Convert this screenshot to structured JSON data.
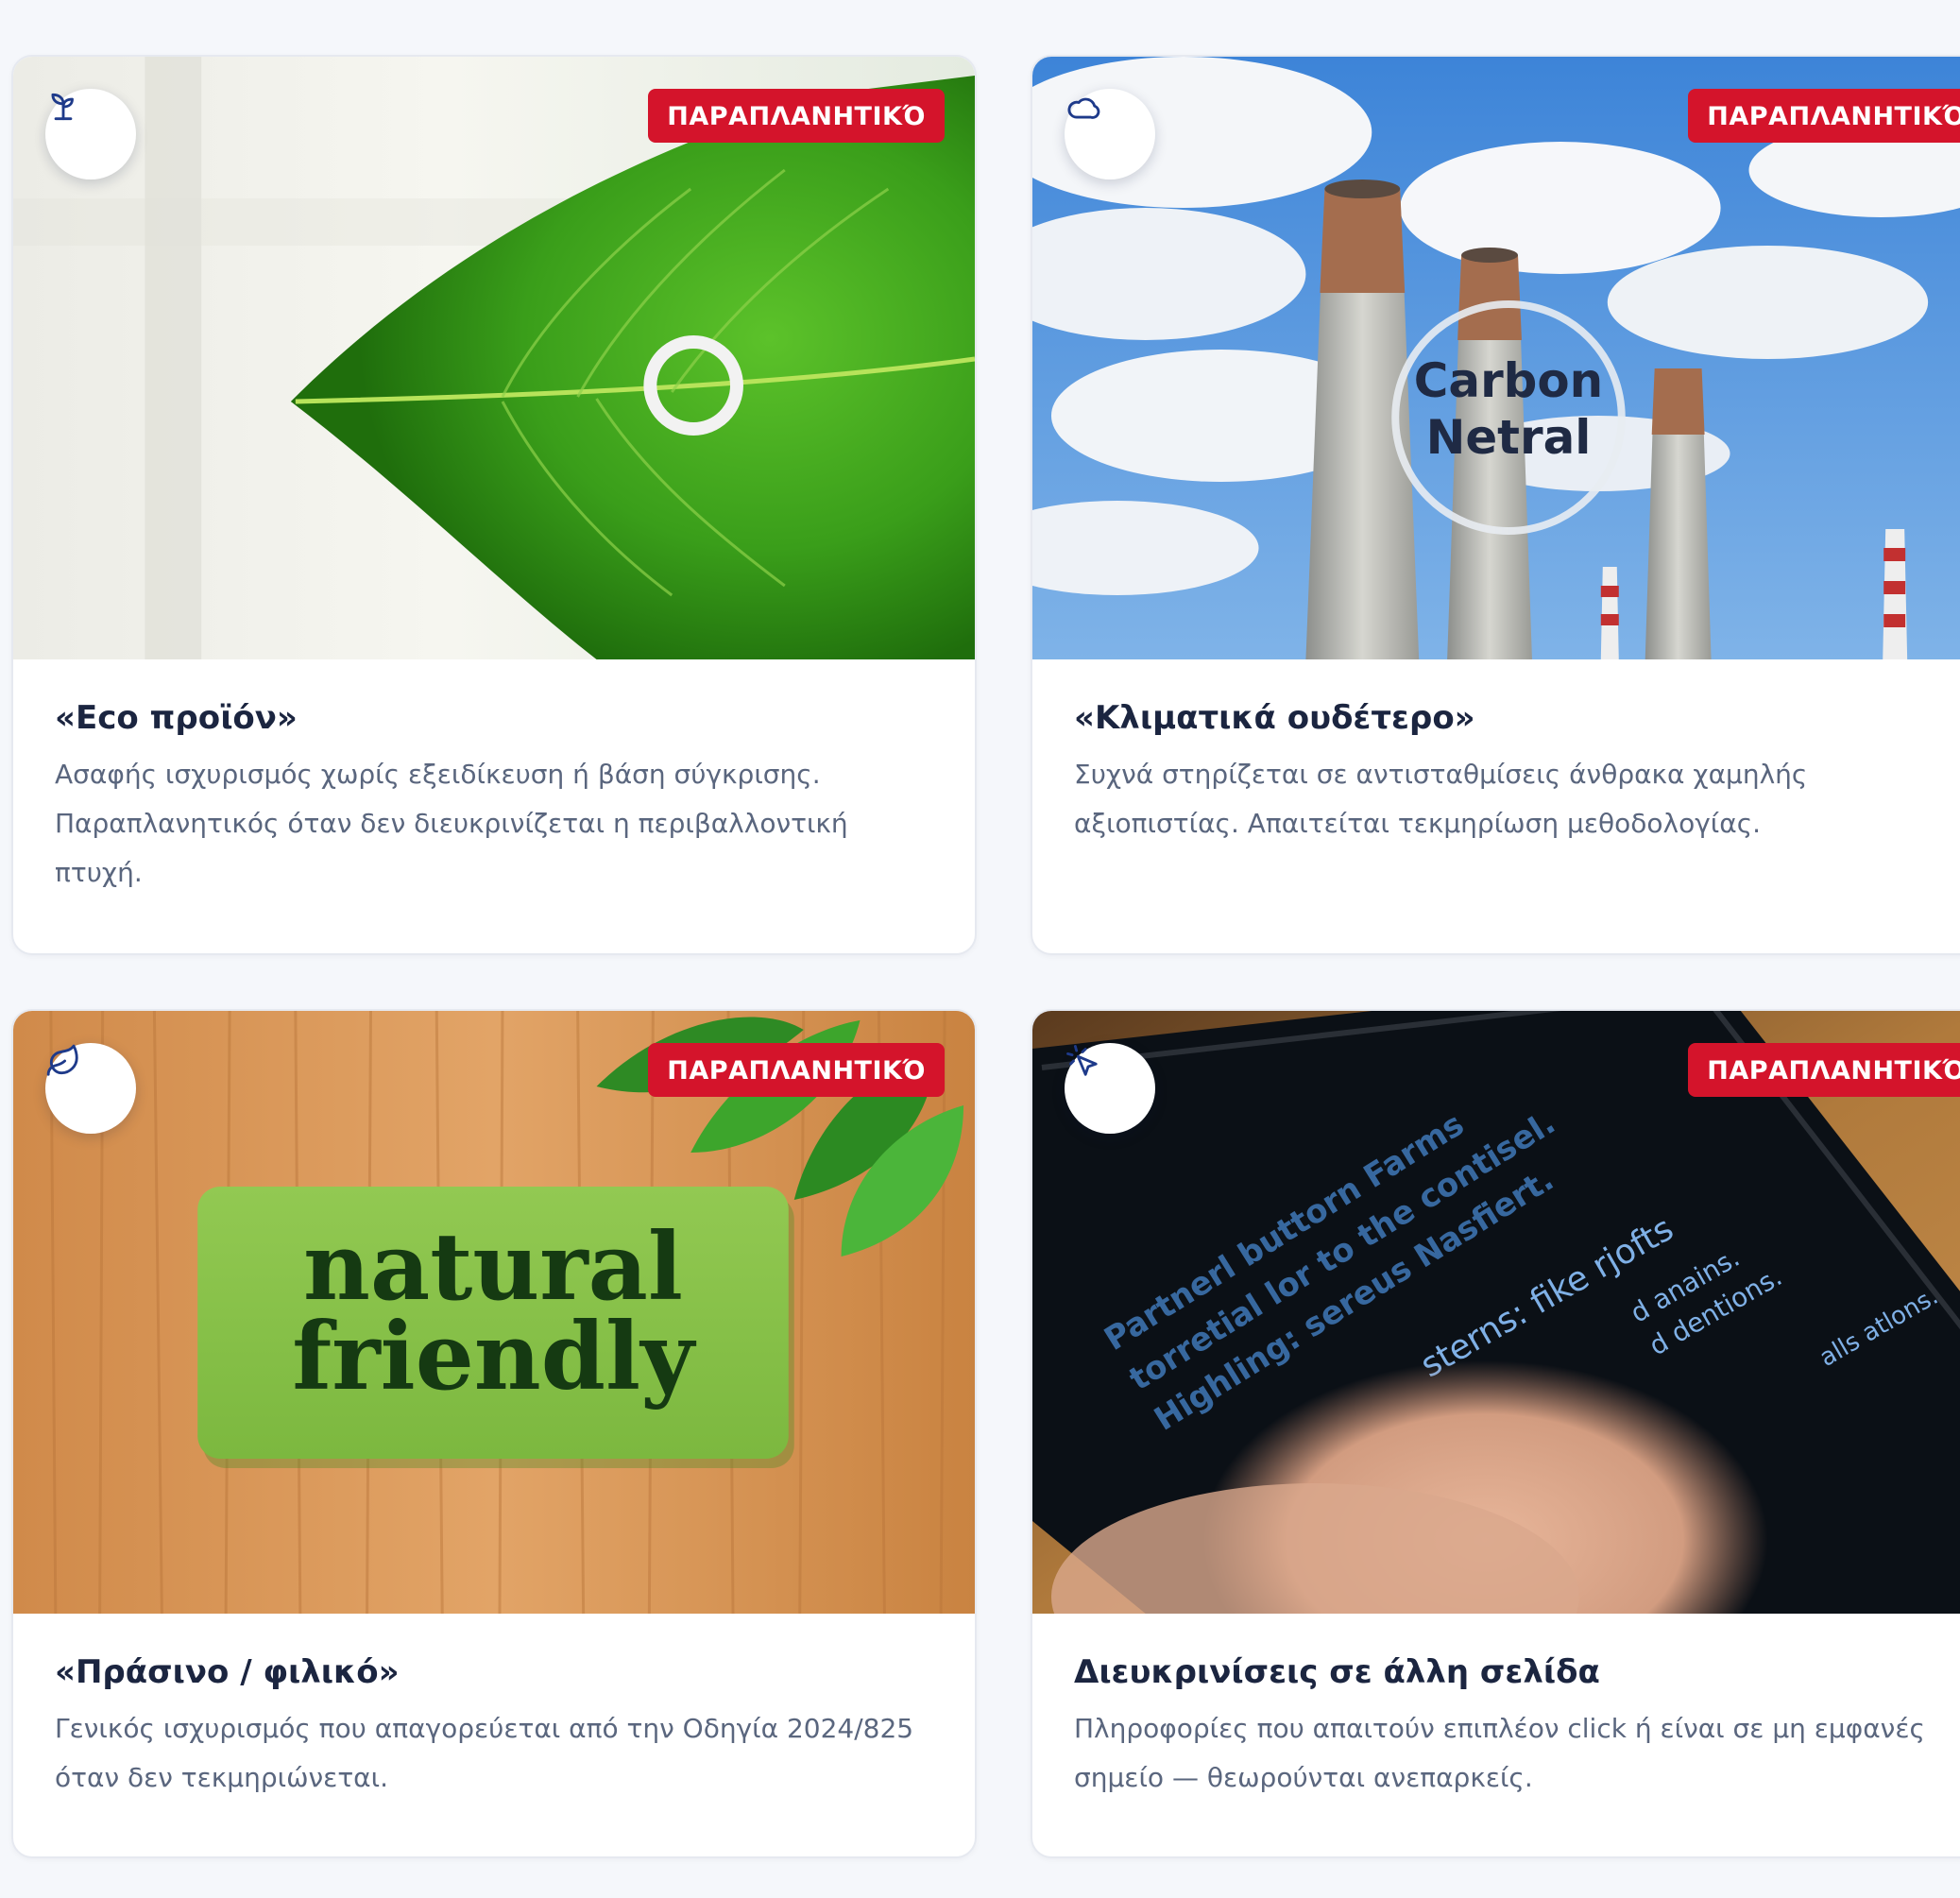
{
  "cards": [
    {
      "icon": "sprout-icon",
      "badge": "ΠΑΡΑΠΛΑΝΗΤΙΚΌ",
      "title": "«Eco προϊόν»",
      "description": "Ασαφής ισχυρισμός χωρίς εξειδίκευση ή βάση σύγκρισης. Παραπλανητικός όταν δεν διευκρινίζεται η περιβαλλοντική πτυχή."
    },
    {
      "icon": "cloud-icon",
      "badge": "ΠΑΡΑΠΛΑΝΗΤΙΚΌ",
      "title": "«Κλιματικά ουδέτερο»",
      "description": "Συχνά στηρίζεται σε αντισταθμίσεις άνθρακα χαμηλής αξιοπιστίας. Απαιτείται τεκμηρίωση μεθοδολογίας.",
      "image_text": [
        "Carbon",
        "Netral"
      ]
    },
    {
      "icon": "leaf-icon",
      "badge": "ΠΑΡΑΠΛΑΝΗΤΙΚΌ",
      "title": "«Πράσινο / φιλικό»",
      "description": "Γενικός ισχυρισμός που απαγορεύεται από την Οδηγία 2024/825 όταν δεν τεκμηριώνεται.",
      "image_text": [
        "natural",
        "friendly"
      ]
    },
    {
      "icon": "pointer-click-icon",
      "badge": "ΠΑΡΑΠΛΑΝΗΤΙΚΌ",
      "title": "Διευκρινίσεις σε άλλη σελίδα",
      "description": "Πληροφορίες που απαιτούν επιπλέον click ή είναι σε μη εμφανές σημείο — θεωρούνται ανεπαρκείς.",
      "image_text": [
        "Partnerl buttorn Farms",
        "torretial lor to the contisel.",
        "Highling: sereus Nasfiert.",
        "sterns: fike rjofts",
        "d anains.",
        "d dentions.",
        "alls atlons."
      ]
    }
  ],
  "colors": {
    "badge": "#d4142b",
    "title": "#1b2540",
    "description": "#5a667e",
    "icon": "#1e3a8a",
    "background": "#f5f7fb"
  }
}
